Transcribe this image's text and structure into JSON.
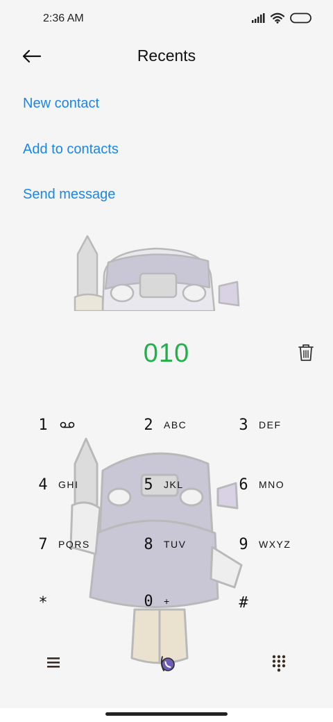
{
  "status_bar": {
    "time": "2:36 AM",
    "icons": [
      "signal-icon",
      "wifi-icon",
      "battery-icon"
    ]
  },
  "header": {
    "title": "Recents",
    "back_icon": "back-arrow-icon"
  },
  "actions": {
    "new_contact": "New contact",
    "add_to_contacts": "Add to contacts",
    "send_message": "Send message"
  },
  "dialer": {
    "number": "010",
    "keys": [
      {
        "digit": "1",
        "letters": ""
      },
      {
        "digit": "2",
        "letters": "ABC"
      },
      {
        "digit": "3",
        "letters": "DEF"
      },
      {
        "digit": "4",
        "letters": "GHI"
      },
      {
        "digit": "5",
        "letters": "JKL"
      },
      {
        "digit": "6",
        "letters": "MNO"
      },
      {
        "digit": "7",
        "letters": "PQRS"
      },
      {
        "digit": "8",
        "letters": "TUV"
      },
      {
        "digit": "9",
        "letters": "WXYZ"
      },
      {
        "digit": "*",
        "letters": ""
      },
      {
        "digit": "0",
        "letters": "+"
      },
      {
        "digit": "#",
        "letters": ""
      }
    ]
  },
  "bottom_bar": {
    "menu_icon": "menu-icon",
    "call_icon": "call-button-icon",
    "keypad_icon": "dialpad-icon"
  },
  "colors": {
    "accent_link": "#1a86e8",
    "number_green": "#22b04b",
    "background": "#f5f5f5"
  }
}
